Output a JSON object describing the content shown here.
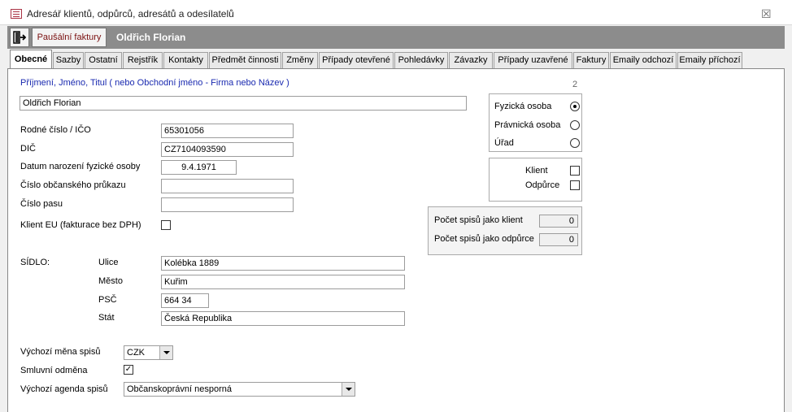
{
  "window": {
    "title": "Adresář klientů, odpůrců, adresátů a odesílatelů",
    "close_glyph": "☒"
  },
  "toolbar": {
    "exit_icon": "exit-door-icon",
    "invoice_button": "Paušální faktury",
    "client_name": "Oldřich Florian"
  },
  "tabs": [
    "Obecné",
    "Sazby",
    "Ostatní",
    "Rejstřík",
    "Kontakty",
    "Předmět činnosti",
    "Změny",
    "Případy otevřené",
    "Pohledávky",
    "Závazky",
    "Případy uzavřené",
    "Faktury",
    "Emaily odchozí",
    "Emaily příchozí"
  ],
  "form": {
    "name_hint": "Příjmení, Jméno, Titul  ( nebo Obchodní jméno - Firma   nebo Název )",
    "record_number": "2",
    "full_name": "Oldřich Florian",
    "birth_number_label": "Rodné číslo / IČO",
    "birth_number": "65301056",
    "vat_label": "DIČ",
    "vat": "CZ7104093590",
    "dob_label": "Datum narození fyzické osoby",
    "dob": "9.4.1971",
    "id_card_label": "Číslo občanského průkazu",
    "id_card": "",
    "passport_label": "Číslo pasu",
    "passport": "",
    "eu_client_label": "Klient EU (fakturace bez DPH)",
    "address_label": "SÍDLO:",
    "street_label": "Ulice",
    "street": "Kolébka 1889",
    "city_label": "Město",
    "city": "Kuřim",
    "zip_label": "PSČ",
    "zip": "664 34",
    "country_label": "Stát",
    "country": "Česká Republika",
    "currency_label": "Výchozí měna spisů",
    "currency": "CZK",
    "contract_fee_label": "Smluvní odměna",
    "contract_fee_checked": "✓",
    "agenda_label": "Výchozí agenda spisů",
    "agenda": "Občanskoprávní nesporná"
  },
  "person_type": {
    "natural": "Fyzická osoba",
    "legal": "Právnická osoba",
    "office": "Úřad",
    "selected": "natural"
  },
  "role": {
    "client_label": "Klient",
    "opponent_label": "Odpůrce"
  },
  "counts": {
    "as_client_label": "Počet spisů jako klient",
    "as_client": "0",
    "as_opponent_label": "Počet spisů jako odpůrce",
    "as_opponent": "0"
  }
}
